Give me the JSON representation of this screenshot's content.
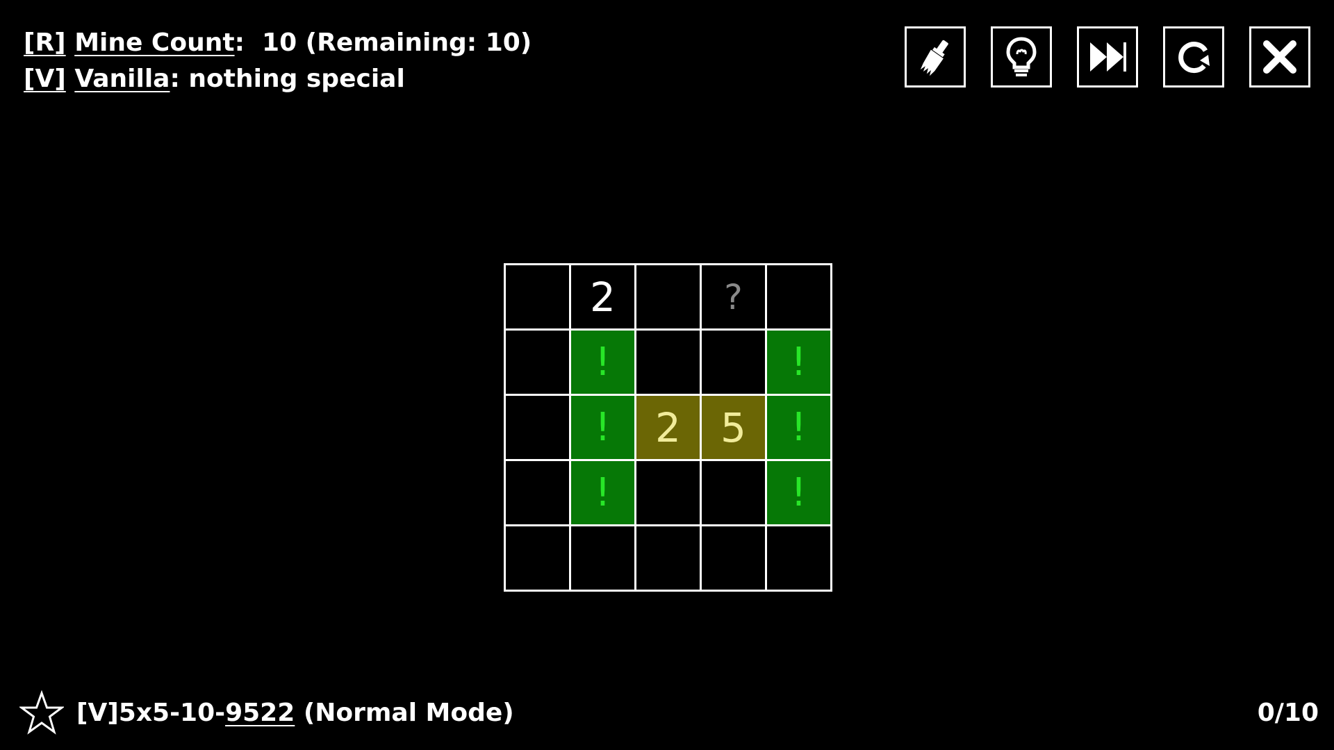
{
  "rules": {
    "line1": {
      "tag": "[R]",
      "name": "Mine Count",
      "rest": ":  10 (Remaining: 10)"
    },
    "line2": {
      "tag": "[V]",
      "name": "Vanilla",
      "rest": ": nothing special"
    }
  },
  "toolbar": {
    "buttons": [
      {
        "icon": "paintbrush-icon"
      },
      {
        "icon": "lightbulb-icon"
      },
      {
        "icon": "fast-forward-icon"
      },
      {
        "icon": "restart-icon"
      },
      {
        "icon": "close-icon"
      }
    ]
  },
  "board": {
    "rows": 5,
    "cols": 5,
    "cells": [
      [
        {
          "t": "empty",
          "v": ""
        },
        {
          "t": "num",
          "v": "2"
        },
        {
          "t": "empty",
          "v": ""
        },
        {
          "t": "unknown",
          "v": "?"
        },
        {
          "t": "empty",
          "v": ""
        }
      ],
      [
        {
          "t": "empty",
          "v": ""
        },
        {
          "t": "flag",
          "v": "!"
        },
        {
          "t": "empty",
          "v": ""
        },
        {
          "t": "empty",
          "v": ""
        },
        {
          "t": "flag",
          "v": "!"
        }
      ],
      [
        {
          "t": "empty",
          "v": ""
        },
        {
          "t": "flag",
          "v": "!"
        },
        {
          "t": "hl",
          "v": "2"
        },
        {
          "t": "hl",
          "v": "5"
        },
        {
          "t": "flag",
          "v": "!"
        }
      ],
      [
        {
          "t": "empty",
          "v": ""
        },
        {
          "t": "flag",
          "v": "!"
        },
        {
          "t": "empty",
          "v": ""
        },
        {
          "t": "empty",
          "v": ""
        },
        {
          "t": "flag",
          "v": "!"
        }
      ],
      [
        {
          "t": "empty",
          "v": ""
        },
        {
          "t": "empty",
          "v": ""
        },
        {
          "t": "empty",
          "v": ""
        },
        {
          "t": "empty",
          "v": ""
        },
        {
          "t": "empty",
          "v": ""
        }
      ]
    ]
  },
  "footer": {
    "puzzle_prefix": "[V]5x5-10-",
    "puzzle_seed": "9522",
    "puzzle_mode": " (Normal Mode)",
    "progress": "0/10"
  },
  "colors": {
    "background": "#000000",
    "flag_cell": "#067806",
    "flag_mark": "#28e628",
    "highlight_cell": "#6b6605",
    "highlight_text": "#f1ec9a"
  }
}
